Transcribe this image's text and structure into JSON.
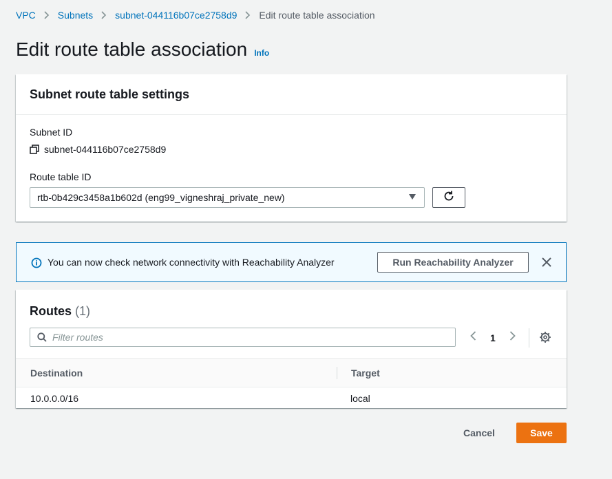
{
  "breadcrumb": {
    "items": [
      "VPC",
      "Subnets",
      "subnet-044116b07ce2758d9"
    ],
    "current": "Edit route table association"
  },
  "page": {
    "title": "Edit route table association",
    "info": "Info"
  },
  "settings": {
    "header": "Subnet route table settings",
    "subnet_id_label": "Subnet ID",
    "subnet_id_value": "subnet-044116b07ce2758d9",
    "route_table_label": "Route table ID",
    "route_table_value": "rtb-0b429c3458a1b602d (eng99_vigneshraj_private_new)"
  },
  "alert": {
    "text": "You can now check network connectivity with Reachability Analyzer",
    "button": "Run Reachability Analyzer"
  },
  "routes": {
    "title": "Routes",
    "count": "(1)",
    "filter_placeholder": "Filter routes",
    "page": "1",
    "columns": [
      "Destination",
      "Target"
    ],
    "rows": [
      {
        "destination": "10.0.0.0/16",
        "target": "local"
      }
    ]
  },
  "actions": {
    "cancel": "Cancel",
    "save": "Save"
  },
  "colors": {
    "link": "#0073bb",
    "primary": "#ec7211",
    "alert_bg": "#f1faff"
  }
}
